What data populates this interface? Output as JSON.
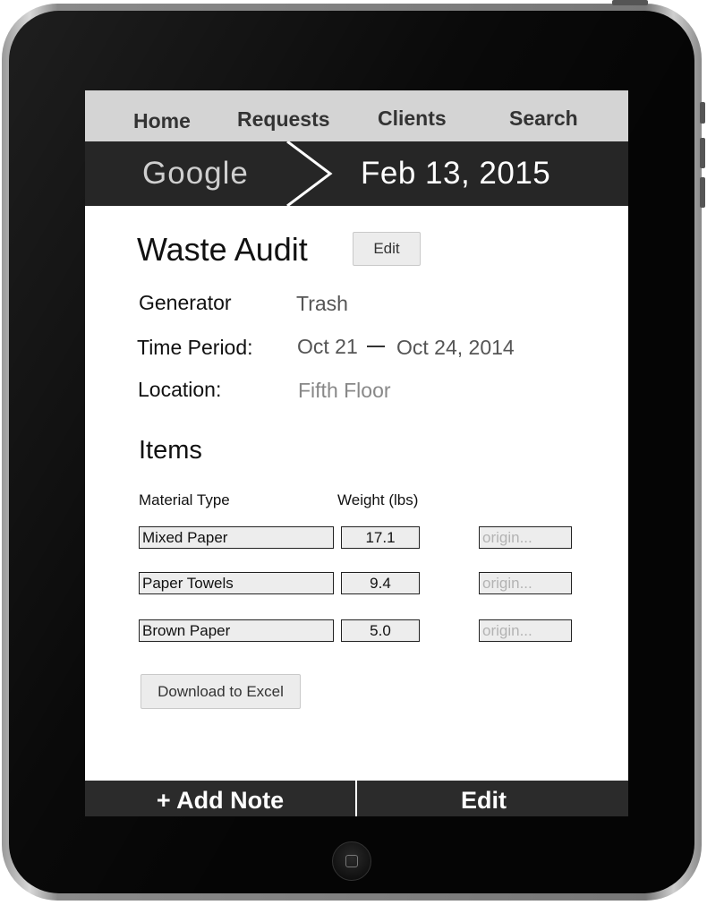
{
  "nav": {
    "tabs": [
      {
        "label": "Home"
      },
      {
        "label": "Requests"
      },
      {
        "label": "Clients"
      },
      {
        "label": "Search"
      }
    ]
  },
  "context": {
    "client": "Google",
    "date": "Feb 13, 2015"
  },
  "audit": {
    "title": "Waste Audit",
    "edit_label": "Edit",
    "fields": {
      "generator": {
        "label": "Generator",
        "value": "Trash"
      },
      "time_period": {
        "label": "Time Period:",
        "start": "Oct 21",
        "end": "Oct 24, 2014"
      },
      "location": {
        "label": "Location:",
        "value": "Fifth Floor"
      }
    }
  },
  "items": {
    "title": "Items",
    "columns": {
      "material": "Material Type",
      "weight": "Weight (lbs)"
    },
    "rows": [
      {
        "material": "Mixed Paper",
        "weight": "17.1",
        "origin_placeholder": "origin..."
      },
      {
        "material": "Paper Towels",
        "weight": "9.4",
        "origin_placeholder": "origin..."
      },
      {
        "material": "Brown Paper",
        "weight": "5.0",
        "origin_placeholder": "origin..."
      }
    ],
    "download_label": "Download to Excel"
  },
  "bottom": {
    "add_note_label": "+ Add Note",
    "edit_label": "Edit"
  },
  "colors": {
    "tabbar": "#d4d4d4",
    "context_bar": "#262626",
    "bottom_bar": "#2b2b2b",
    "device_bezel": "#050505"
  },
  "icons": {
    "separator": "chevron-right-icon",
    "home": "home-button-icon"
  }
}
